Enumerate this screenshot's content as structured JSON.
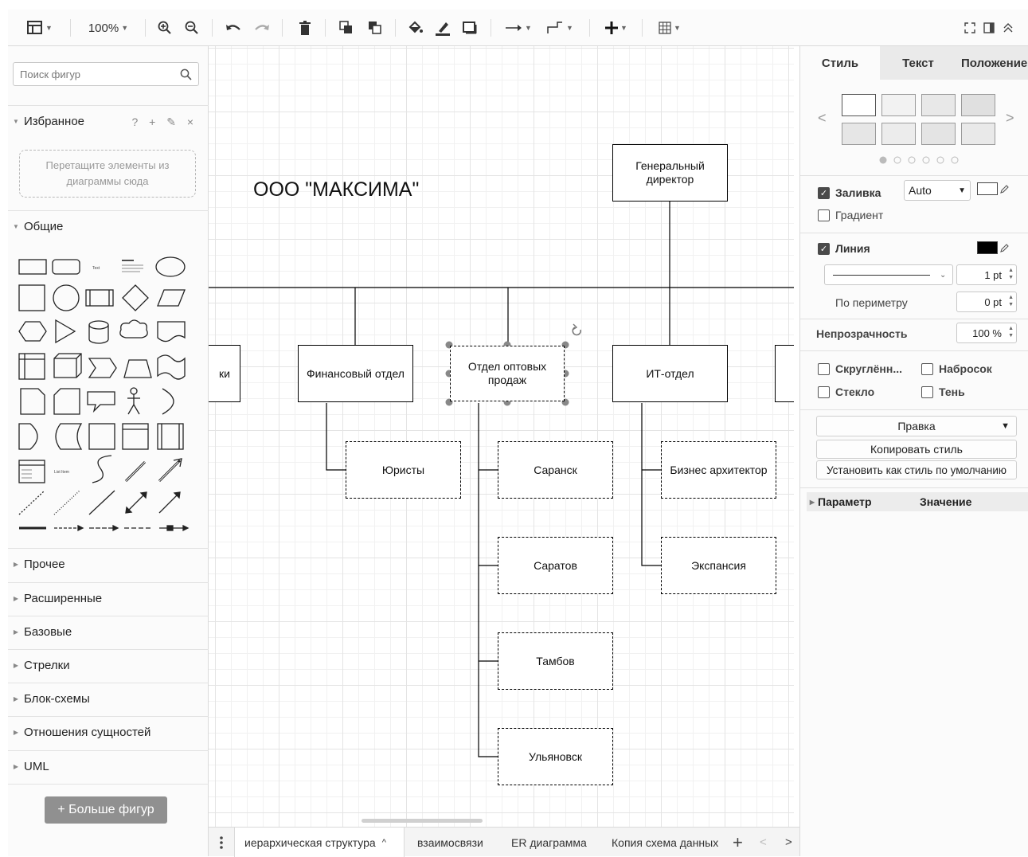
{
  "toolbar": {
    "zoom": "100%",
    "icons": [
      "format-panel-icon",
      "zoom-in-icon",
      "zoom-out-icon",
      "undo-icon",
      "redo-icon",
      "delete-icon",
      "to-front-icon",
      "to-back-icon",
      "fill-color-icon",
      "line-color-icon",
      "shadow-icon",
      "connection-icon",
      "waypoints-icon",
      "insert-icon",
      "table-icon",
      "fullscreen-icon",
      "toggle-panel-icon",
      "collapse-icon"
    ]
  },
  "sidebar": {
    "search_placeholder": "Поиск фигур",
    "favorites": {
      "title": "Избранное",
      "tools": "? + ✎ ×",
      "drop_hint": "Перетащите элементы из диаграммы сюда"
    },
    "general": {
      "title": "Общие"
    },
    "sections": [
      "Прочее",
      "Расширенные",
      "Базовые",
      "Стрелки",
      "Блок-схемы",
      "Отношения сущностей",
      "UML"
    ],
    "more_shapes": "+ Больше фигур"
  },
  "diagram": {
    "company_title": "ООО \"МАКСИМА\"",
    "nodes": {
      "ceo": "Генеральный директор",
      "partial": "ки",
      "finance": "Финансовый отдел",
      "wholesale": "Отдел оптовых продаж",
      "it": "ИТ-отдел",
      "lawyers": "Юристы",
      "saransk": "Саранск",
      "saratov": "Саратов",
      "tambov": "Тамбов",
      "ulyanovsk": "Ульяновск",
      "business_architect": "Бизнес архитектор",
      "expansion": "Экспансия"
    }
  },
  "tabs": {
    "items": [
      "иерархическая структура",
      "взаимосвязи",
      "ER диаграмма",
      "Копия схема данных"
    ],
    "active": "иерархическая структура",
    "add": "+"
  },
  "format_panel": {
    "tabs": [
      "Стиль",
      "Текст",
      "Положение"
    ],
    "fill": {
      "label": "Заливка",
      "value": "Auto",
      "checked": true
    },
    "gradient": {
      "label": "Градиент",
      "checked": false
    },
    "line": {
      "label": "Линия",
      "checked": true,
      "color": "#000000",
      "width": "1 pt"
    },
    "perimeter": {
      "label": "По периметру",
      "value": "0 pt"
    },
    "opacity": {
      "label": "Непрозрачность",
      "value": "100 %"
    },
    "options": {
      "rounded": "Скруглённ...",
      "sketch": "Набросок",
      "glass": "Стекло",
      "shadow": "Тень"
    },
    "edit_select": "Правка",
    "copy_style": "Копировать стиль",
    "set_default": "Установить как стиль по умолчанию",
    "table_header": {
      "param": "Параметр",
      "value": "Значение"
    }
  }
}
